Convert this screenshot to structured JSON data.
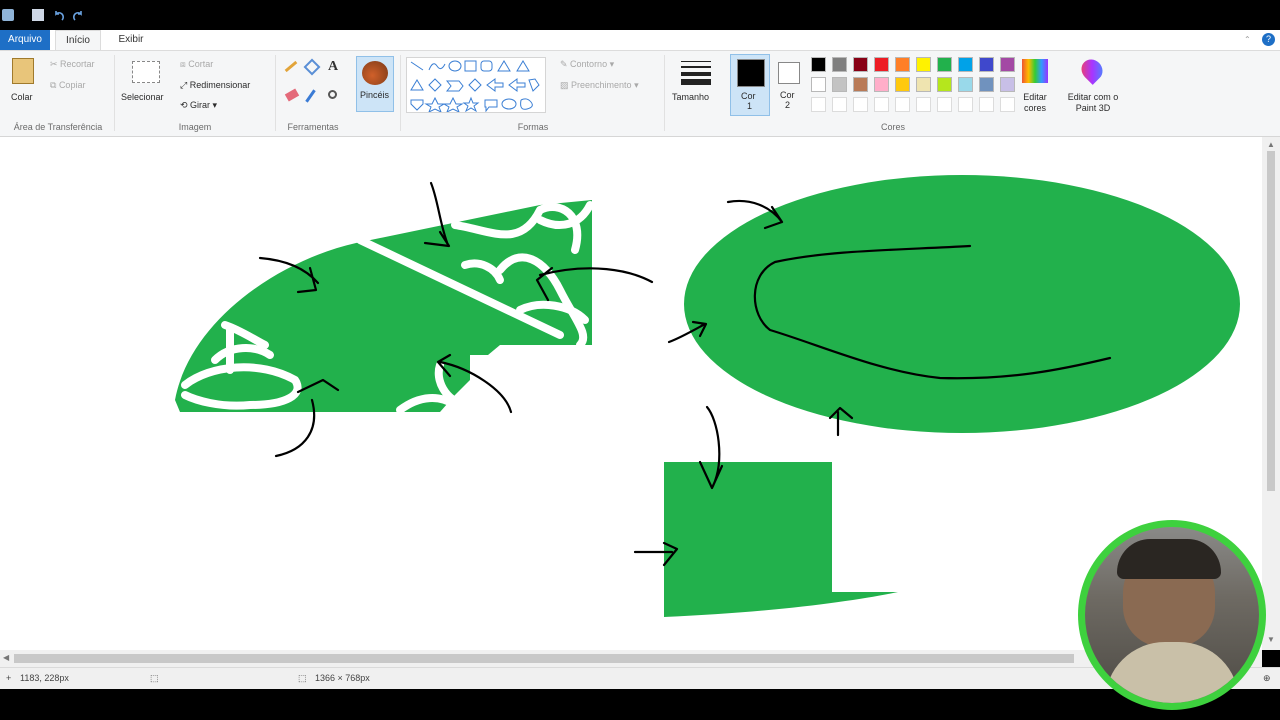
{
  "tabs": {
    "file": "Arquivo",
    "home": "Início",
    "view": "Exibir"
  },
  "clipboard": {
    "paste": "Colar",
    "cut": "Recortar",
    "copy": "Copiar",
    "label": "Área de Transferência"
  },
  "image": {
    "select": "Selecionar",
    "crop": "Cortar",
    "resize": "Redimensionar",
    "rotate": "Girar",
    "label": "Imagem"
  },
  "tools": {
    "brushes": "Pincéis",
    "label": "Ferramentas"
  },
  "shapes": {
    "outline": "Contorno",
    "fill": "Preenchimento",
    "label": "Formas"
  },
  "size": {
    "label": "Tamanho"
  },
  "color1": {
    "label": "Cor",
    "num": "1"
  },
  "color2": {
    "label": "Cor",
    "num": "2"
  },
  "colors": {
    "label": "Cores",
    "edit": "Editar cores",
    "paint3d": "Editar com o Paint 3D",
    "row1": [
      "#000000",
      "#7f7f7f",
      "#880015",
      "#ed1c24",
      "#ff7f27",
      "#fff200",
      "#22b14c",
      "#00a2e8",
      "#3f48cc",
      "#a349a4"
    ],
    "row2": [
      "#ffffff",
      "#c3c3c3",
      "#b97a57",
      "#ffaec9",
      "#ffc90e",
      "#efe4b0",
      "#b5e61d",
      "#99d9ea",
      "#7092be",
      "#c8bfe7"
    ]
  },
  "accent": {
    "green": "#22b14c",
    "ribbon_blue": "#1e6fc6",
    "webcam_ring": "#3ed13e"
  },
  "status": {
    "cursor": "1183, 228px",
    "canvas_size": "1366 × 768px"
  }
}
